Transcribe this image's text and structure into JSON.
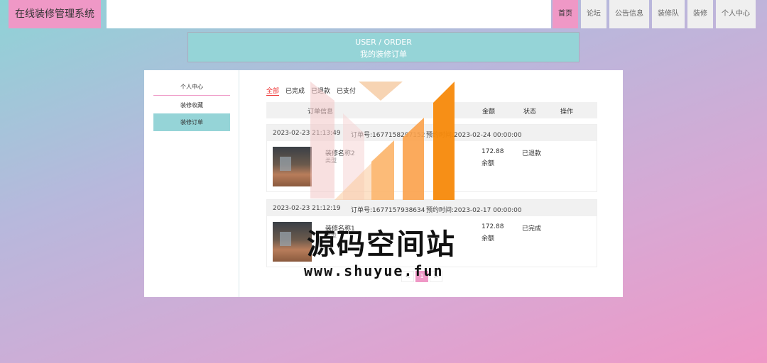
{
  "header": {
    "logo": "在线装修管理系统",
    "nav": [
      "首页",
      "论坛",
      "公告信息",
      "装修队",
      "装修",
      "个人中心"
    ]
  },
  "title": {
    "en": "USER / ORDER",
    "cn": "我的装修订单"
  },
  "sidebar": {
    "items": [
      "个人中心",
      "装修收藏",
      "装修订单"
    ]
  },
  "tabs": [
    "全部",
    "已完成",
    "已退款",
    "已支付"
  ],
  "table_head": {
    "item": "订单信息",
    "amount": "金额",
    "status": "状态",
    "action": "操作"
  },
  "orders": [
    {
      "date": "2023-02-23 21:13:49",
      "order_no": "订单号:1677158297152",
      "booking": "预约时间:2023-02-24 00:00:00",
      "name": "装修名称2",
      "type": "类型",
      "amount": "172.88",
      "pay": "余额",
      "status": "已退款"
    },
    {
      "date": "2023-02-23 21:12:19",
      "order_no": "订单号:1677157938634",
      "booking": "预约时间:2023-02-17 00:00:00",
      "name": "装修名称1",
      "type": "类型",
      "amount": "172.88",
      "pay": "余额",
      "status": "已完成"
    }
  ],
  "pager": [
    "<",
    "1",
    ">"
  ],
  "watermark": {
    "text": "源码空间站",
    "url": "www.shuyue.fun"
  },
  "colors": {
    "pink": "#ef98c6",
    "teal": "#95d4d7",
    "orange": "#f7890a"
  }
}
